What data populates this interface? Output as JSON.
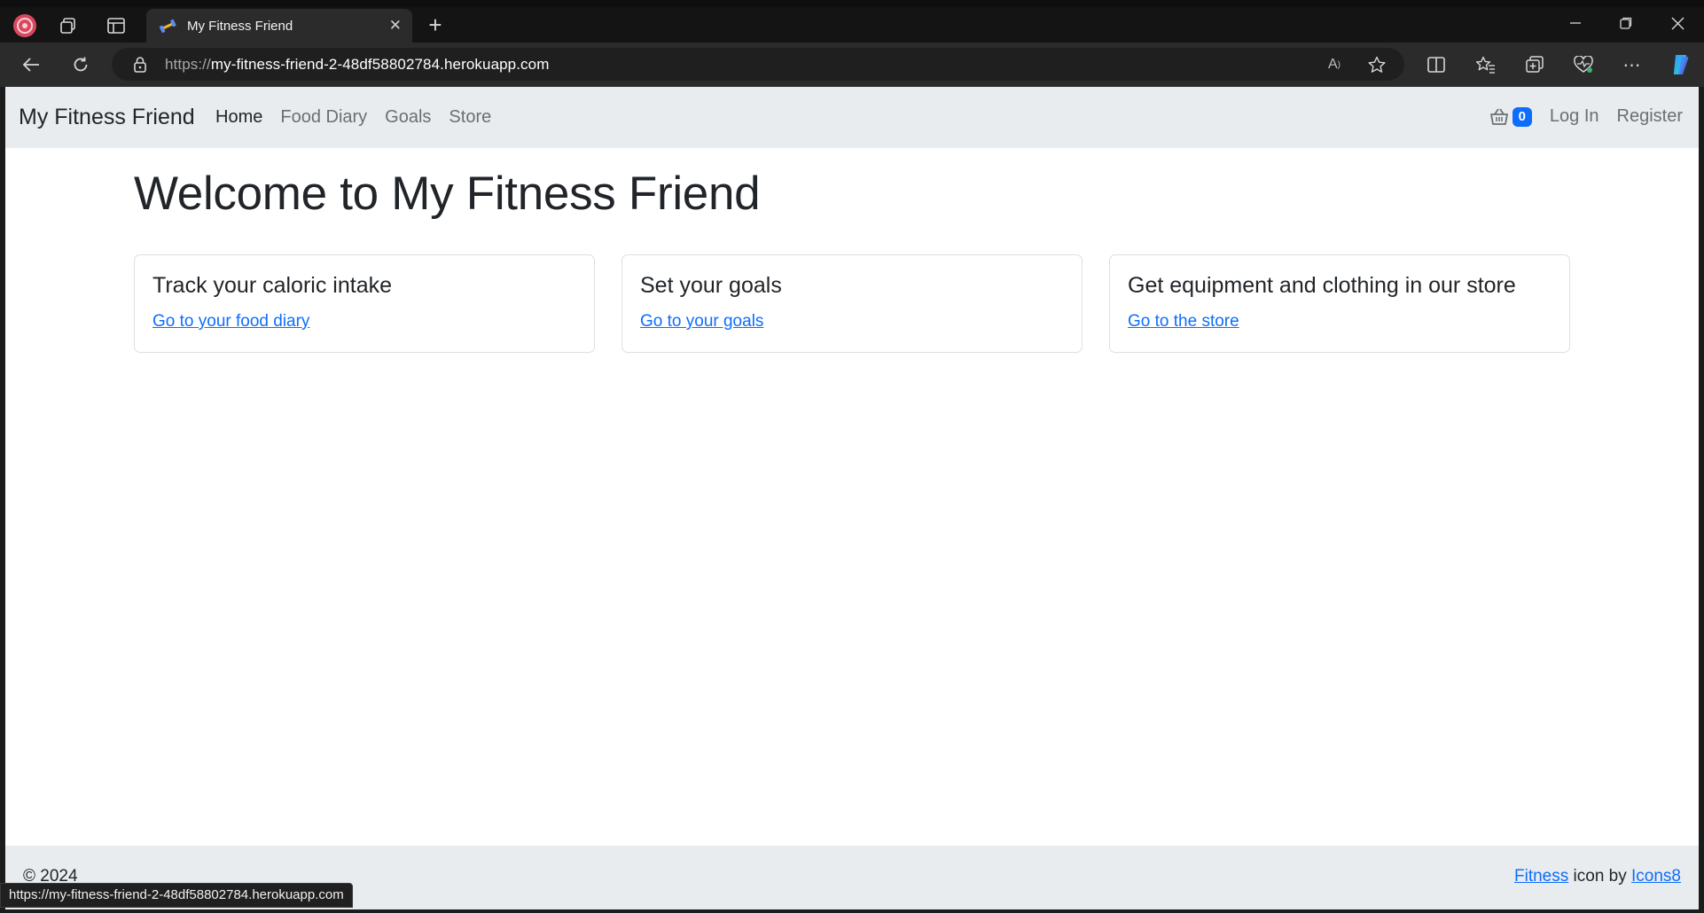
{
  "browser": {
    "tab_title": "My Fitness Friend",
    "url_scheme": "https://",
    "url_host": "my-fitness-friend-2-48df58802784.herokuapp.com",
    "status_url": "https://my-fitness-friend-2-48df58802784.herokuapp.com",
    "icons": [
      "profile-icon",
      "workspaces-icon",
      "tab-actions-icon",
      "close-tab-icon",
      "new-tab-icon",
      "minimize-icon",
      "restore-icon",
      "close-window-icon",
      "back-icon",
      "refresh-icon",
      "lock-icon",
      "read-aloud-icon",
      "favorite-star-icon",
      "split-screen-icon",
      "favorites-icon",
      "collections-icon",
      "browser-essentials-icon",
      "more-icon",
      "copilot-icon"
    ]
  },
  "navbar": {
    "brand": "My Fitness Friend",
    "links": [
      "Home",
      "Food Diary",
      "Goals",
      "Store"
    ],
    "active": "Home",
    "basket_count": "0",
    "login": "Log In",
    "register": "Register"
  },
  "main": {
    "title": "Welcome to My Fitness Friend",
    "cards": [
      {
        "title": "Track your caloric intake",
        "link": "Go to your food diary"
      },
      {
        "title": "Set your goals",
        "link": "Go to your goals"
      },
      {
        "title": "Get equipment and clothing in our store",
        "link": "Go to the store"
      }
    ]
  },
  "footer": {
    "copyright": "© 2024",
    "credit_link1": "Fitness",
    "credit_middle": " icon by ",
    "credit_link2": "Icons8"
  },
  "colors": {
    "primary": "#0d6efd",
    "navbar_bg": "#e9ecef",
    "text": "#212529"
  }
}
